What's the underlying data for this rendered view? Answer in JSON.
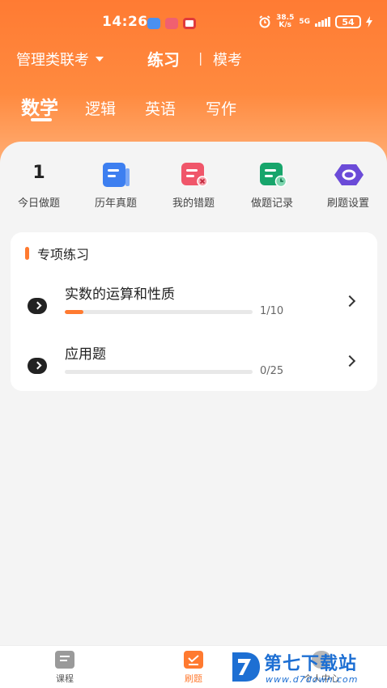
{
  "status_bar": {
    "time": "14:26",
    "speed_value": "38.5",
    "speed_unit": "K/s",
    "network": "5G",
    "battery": "54"
  },
  "top_nav": {
    "exam_type": "管理类联考",
    "practice": "练习",
    "separator": "|",
    "mock": "模考"
  },
  "subjects": {
    "tabs": [
      "数学",
      "逻辑",
      "英语",
      "写作"
    ],
    "active_index": 0
  },
  "quick_actions": {
    "today_count": "1",
    "today_label": "今日做题",
    "past_papers": "历年真题",
    "wrong_questions": "我的错题",
    "records": "做题记录",
    "settings": "刷题设置"
  },
  "special_practice": {
    "title": "专项练习",
    "items": [
      {
        "name": "实数的运算和性质",
        "progress_text": "1/10",
        "progress_fraction": 0.1
      },
      {
        "name": "应用题",
        "progress_text": "0/25",
        "progress_fraction": 0
      }
    ]
  },
  "tab_bar": {
    "course": "课程",
    "practice": "刷题",
    "profile": "个人中心"
  },
  "watermark": {
    "title": "第七下载站",
    "url": "www.d7down.com"
  },
  "colors": {
    "accent": "#ff7a30",
    "header_gradient_top": "#ff7b33",
    "past_papers_icon": "#3d7ff0",
    "wrong_icon": "#f0566a",
    "records_icon": "#17a56b",
    "settings_icon": "#6b4bd8",
    "watermark_blue": "#1d6fd3"
  }
}
